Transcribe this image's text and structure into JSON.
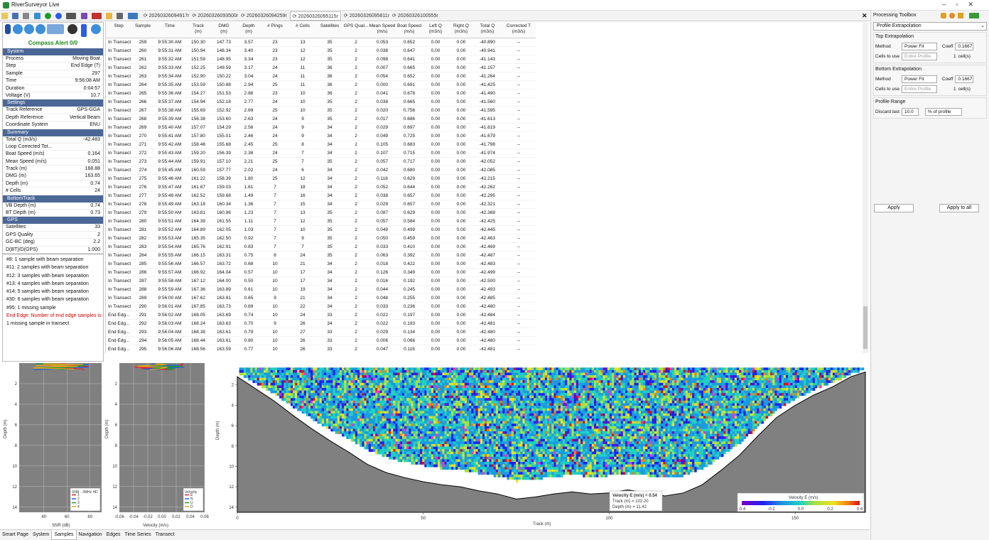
{
  "window": {
    "title": "RiverSurveyor Live",
    "controls": [
      "–",
      "▫",
      "✕"
    ]
  },
  "file_tabs": [
    "20260326094917r",
    "20260326093500r",
    "20260326094259r",
    "20260326095115r",
    "20260326095811r",
    "20260326100555r"
  ],
  "file_tab_selected": 3,
  "left": {
    "alert": "Compass Alert 0/0",
    "sections": [
      {
        "name": "System",
        "rows": [
          [
            "Process",
            "Moving Boat"
          ],
          [
            "Step",
            "End Edge (?)"
          ],
          [
            "Sample",
            "297"
          ],
          [
            "Time",
            "9:56:08 AM"
          ],
          [
            "Duration",
            "0:04:57"
          ],
          [
            "Voltage (V)",
            "10.7"
          ]
        ]
      },
      {
        "name": "Settings",
        "rows": [
          [
            "Track Reference",
            "GPS-GGA"
          ],
          [
            "Depth Reference",
            "Vertical Beam"
          ],
          [
            "Coordinate System",
            "ENU"
          ]
        ]
      },
      {
        "name": "Summary",
        "rows": [
          [
            "Total Q (m3/s)",
            "-42.483"
          ],
          [
            "Loop Corrected Tot...",
            ""
          ],
          [
            "Boat Speed (m/s)",
            "0.164"
          ],
          [
            "Mean Speed (m/s)",
            "0.051"
          ],
          [
            "Track (m)",
            "168.88"
          ],
          [
            "DMG (m)",
            "163.65"
          ],
          [
            "Depth (m)",
            "0.74"
          ],
          [
            "# Cells",
            "24"
          ]
        ]
      },
      {
        "name": "BottomTrack",
        "rows": [
          [
            "VB Depth (m)",
            "0.74"
          ],
          [
            "BT Depth (m)",
            "0.73"
          ]
        ]
      },
      {
        "name": "GPS",
        "rows": [
          [
            "Satellites",
            "33"
          ],
          [
            "GPS Quality",
            "2"
          ],
          [
            "GC-BC (deg)",
            "2.2"
          ],
          [
            "D(BT)/D(GPS)",
            "1.000"
          ]
        ]
      }
    ],
    "messages": [
      {
        "text": "#8: 1 sample with beam separation",
        "red": false
      },
      {
        "text": "#11: 2 samples with beam separation",
        "red": false
      },
      {
        "text": "#12: 3 samples with beam separation",
        "red": false
      },
      {
        "text": "#13: 4 samples with beam separation",
        "red": false
      },
      {
        "text": "#14: 5 samples with beam separation",
        "red": false
      },
      {
        "text": "#30: 6 samples with beam separation",
        "red": false
      },
      {
        "text": "#95: 1 missing sample",
        "red": false
      },
      {
        "text": "End Edge: Number of end edge samples is l",
        "red": true
      },
      {
        "text": "1 missing sample in transect",
        "red": false
      }
    ]
  },
  "table": {
    "headers": [
      "Step",
      "Sample",
      "Time",
      "Track\n(m)",
      "DMG\n(m)",
      "Depth\n(m)",
      "# Pings",
      "# Cells",
      "Satellites",
      "GPS Qual...",
      "Mean Speed\n(m/s)",
      "Boat Speed\n(m/s)",
      "Left Q\n(m3/s)",
      "Right Q\n(m3/s)",
      "Total Q\n(m3/s)",
      "Corrected T\n(m3/s)"
    ],
    "rows": [
      [
        "In Transect",
        "259",
        "9:55:30 AM",
        "150.30",
        "147.73",
        "3.57",
        "23",
        "13",
        "35",
        "2",
        "0.053",
        "0.652",
        "0.00",
        "0.00",
        "-40.890",
        "--"
      ],
      [
        "In Transect",
        "260",
        "9:55:31 AM",
        "150.94",
        "148.34",
        "3.40",
        "23",
        "12",
        "35",
        "2",
        "0.038",
        "0.647",
        "0.00",
        "0.00",
        "-40.941",
        "--"
      ],
      [
        "In Transect",
        "261",
        "9:55:32 AM",
        "151.59",
        "148.95",
        "3.34",
        "23",
        "12",
        "35",
        "2",
        "0.098",
        "0.641",
        "0.00",
        "0.00",
        "-41.143",
        "--"
      ],
      [
        "In Transect",
        "262",
        "9:55:33 AM",
        "152.25",
        "149.59",
        "3.17",
        "24",
        "11",
        "36",
        "2",
        "0.007",
        "0.665",
        "0.00",
        "0.00",
        "-41.157",
        "--"
      ],
      [
        "In Transect",
        "263",
        "9:55:34 AM",
        "152.90",
        "150.22",
        "3.04",
        "24",
        "11",
        "36",
        "2",
        "0.054",
        "0.652",
        "0.00",
        "0.00",
        "-41.264",
        "--"
      ],
      [
        "In Transect",
        "264",
        "9:55:35 AM",
        "153.59",
        "150.88",
        "2.94",
        "25",
        "11",
        "36",
        "2",
        "0.000",
        "0.691",
        "0.00",
        "0.00",
        "-41.425",
        "--"
      ],
      [
        "In Transect",
        "265",
        "9:55:36 AM",
        "154.27",
        "151.53",
        "2.88",
        "23",
        "10",
        "36",
        "2",
        "0.041",
        "0.678",
        "0.00",
        "0.00",
        "-41.490",
        "--"
      ],
      [
        "In Transect",
        "266",
        "9:55:37 AM",
        "154.94",
        "152.18",
        "2.77",
        "24",
        "10",
        "35",
        "2",
        "0.038",
        "0.665",
        "0.00",
        "0.00",
        "-41.560",
        "--"
      ],
      [
        "In Transect",
        "267",
        "9:55:38 AM",
        "155.69",
        "152.92",
        "2.69",
        "25",
        "10",
        "35",
        "2",
        "0.020",
        "0.756",
        "0.00",
        "0.00",
        "-41.595",
        "--"
      ],
      [
        "In Transect",
        "268",
        "9:55:39 AM",
        "156.38",
        "153.60",
        "2.63",
        "24",
        "9",
        "35",
        "2",
        "0.017",
        "0.686",
        "0.00",
        "0.00",
        "-41.613",
        "--"
      ],
      [
        "In Transect",
        "269",
        "9:55:40 AM",
        "157.07",
        "154.29",
        "2.56",
        "24",
        "9",
        "34",
        "2",
        "0.029",
        "0.697",
        "0.00",
        "0.00",
        "-41.619",
        "--"
      ],
      [
        "In Transect",
        "270",
        "9:55:41 AM",
        "157.80",
        "155.01",
        "2.46",
        "24",
        "9",
        "34",
        "2",
        "0.049",
        "0.725",
        "0.00",
        "0.00",
        "-41.679",
        "--"
      ],
      [
        "In Transect",
        "271",
        "9:55:42 AM",
        "158.48",
        "155.68",
        "2.45",
        "25",
        "8",
        "34",
        "2",
        "0.105",
        "0.683",
        "0.00",
        "0.00",
        "-41.798",
        "--"
      ],
      [
        "In Transect",
        "272",
        "9:55:43 AM",
        "159.20",
        "156.39",
        "2.38",
        "24",
        "7",
        "34",
        "2",
        "0.107",
        "0.715",
        "0.00",
        "0.00",
        "-41.974",
        "--"
      ],
      [
        "In Transect",
        "273",
        "9:55:44 AM",
        "159.91",
        "157.10",
        "2.21",
        "25",
        "7",
        "35",
        "2",
        "0.057",
        "0.717",
        "0.00",
        "0.00",
        "-42.052",
        "--"
      ],
      [
        "In Transect",
        "274",
        "9:55:45 AM",
        "160.59",
        "157.77",
        "2.02",
        "24",
        "6",
        "34",
        "2",
        "0.042",
        "0.680",
        "0.00",
        "0.00",
        "-42.085",
        "--"
      ],
      [
        "In Transect",
        "275",
        "9:55:46 AM",
        "161.22",
        "158.39",
        "1.80",
        "25",
        "12",
        "34",
        "2",
        "0.116",
        "0.629",
        "0.00",
        "0.00",
        "-42.215",
        "--"
      ],
      [
        "In Transect",
        "276",
        "9:55:47 AM",
        "161.87",
        "159.03",
        "1.61",
        "7",
        "18",
        "34",
        "2",
        "0.052",
        "0.644",
        "0.00",
        "0.00",
        "-42.262",
        "--"
      ],
      [
        "In Transect",
        "277",
        "9:55:48 AM",
        "162.52",
        "159.68",
        "1.49",
        "7",
        "16",
        "34",
        "2",
        "0.038",
        "0.657",
        "0.00",
        "0.00",
        "-42.295",
        "--"
      ],
      [
        "In Transect",
        "278",
        "9:55:49 AM",
        "163.18",
        "160.34",
        "1.36",
        "7",
        "15",
        "34",
        "2",
        "0.029",
        "0.657",
        "0.00",
        "0.00",
        "-42.321",
        "--"
      ],
      [
        "In Transect",
        "279",
        "9:55:50 AM",
        "163.81",
        "160.96",
        "1.23",
        "7",
        "13",
        "35",
        "2",
        "0.087",
        "0.629",
        "0.00",
        "0.00",
        "-42.388",
        "--"
      ],
      [
        "In Transect",
        "280",
        "9:55:51 AM",
        "164.39",
        "161.55",
        "1.11",
        "7",
        "12",
        "35",
        "2",
        "0.057",
        "0.584",
        "0.00",
        "0.00",
        "-42.425",
        "--"
      ],
      [
        "In Transect",
        "281",
        "9:55:52 AM",
        "164.89",
        "162.05",
        "1.03",
        "7",
        "10",
        "35",
        "2",
        "0.049",
        "0.499",
        "0.00",
        "0.00",
        "-42.445",
        "--"
      ],
      [
        "In Transect",
        "282",
        "9:55:53 AM",
        "165.35",
        "162.50",
        "0.92",
        "7",
        "9",
        "35",
        "2",
        "0.050",
        "0.459",
        "0.00",
        "0.00",
        "-42.463",
        "--"
      ],
      [
        "In Transect",
        "283",
        "9:55:54 AM",
        "165.76",
        "162.91",
        "0.83",
        "7",
        "7",
        "35",
        "2",
        "0.033",
        "0.410",
        "0.00",
        "0.00",
        "-42.469",
        "--"
      ],
      [
        "In Transect",
        "284",
        "9:55:55 AM",
        "166.15",
        "163.31",
        "0.75",
        "8",
        "24",
        "35",
        "2",
        "0.063",
        "0.392",
        "0.00",
        "0.00",
        "-42.487",
        "--"
      ],
      [
        "In Transect",
        "285",
        "9:55:56 AM",
        "166.57",
        "163.72",
        "0.68",
        "10",
        "21",
        "34",
        "2",
        "0.018",
        "0.422",
        "0.00",
        "0.00",
        "-42.483",
        "--"
      ],
      [
        "In Transect",
        "286",
        "9:55:57 AM",
        "166.92",
        "164.04",
        "0.57",
        "10",
        "17",
        "34",
        "2",
        "0.126",
        "0.349",
        "0.00",
        "0.00",
        "-42.499",
        "--"
      ],
      [
        "In Transect",
        "287",
        "9:55:58 AM",
        "167.12",
        "164.00",
        "0.50",
        "10",
        "17",
        "34",
        "2",
        "0.016",
        "0.192",
        "0.00",
        "0.00",
        "-42.500",
        "--"
      ],
      [
        "In Transect",
        "288",
        "9:55:59 AM",
        "167.36",
        "163.89",
        "0.61",
        "10",
        "19",
        "34",
        "2",
        "0.044",
        "0.245",
        "0.00",
        "0.00",
        "-42.493",
        "--"
      ],
      [
        "In Transect",
        "289",
        "9:56:00 AM",
        "167.62",
        "163.81",
        "0.65",
        "9",
        "21",
        "34",
        "2",
        "0.048",
        "0.255",
        "0.00",
        "0.00",
        "-42.485",
        "--"
      ],
      [
        "In Transect",
        "290",
        "9:56:01 AM",
        "167.85",
        "163.73",
        "0.69",
        "10",
        "22",
        "34",
        "2",
        "0.033",
        "0.236",
        "0.00",
        "0.00",
        "-42.480",
        "--"
      ],
      [
        "End Edg...",
        "291",
        "9:56:02 AM",
        "168.05",
        "163.69",
        "0.74",
        "10",
        "24",
        "33",
        "2",
        "0.022",
        "0.197",
        "0.00",
        "0.00",
        "-42.484",
        "--"
      ],
      [
        "End Edg...",
        "292",
        "9:56:03 AM",
        "168.24",
        "163.63",
        "0.70",
        "9",
        "26",
        "34",
        "2",
        "0.022",
        "0.193",
        "0.00",
        "0.00",
        "-42.481",
        "--"
      ],
      [
        "End Edg...",
        "293",
        "9:56:04 AM",
        "168.38",
        "163.61",
        "0.79",
        "10",
        "27",
        "33",
        "2",
        "0.029",
        "0.134",
        "0.00",
        "0.00",
        "-42.480",
        "--"
      ],
      [
        "End Edg...",
        "294",
        "9:56:05 AM",
        "168.44",
        "163.61",
        "0.80",
        "10",
        "26",
        "33",
        "2",
        "0.006",
        "0.066",
        "0.00",
        "0.00",
        "-42.480",
        "--"
      ],
      [
        "End Edg...",
        "295",
        "9:56:06 AM",
        "168.56",
        "163.59",
        "0.77",
        "10",
        "26",
        "33",
        "2",
        "0.047",
        "0.116",
        "0.00",
        "0.00",
        "-42.481",
        "--"
      ],
      [
        "End Edg...",
        "296",
        "9:56:07 AM",
        "168.71",
        "163.63",
        "0.75",
        "10",
        "25",
        "34",
        "2",
        "0.037",
        "0.154",
        "0.00",
        "0.00",
        "-42.482",
        "--"
      ],
      [
        "End Edg...",
        "297",
        "9:56:08 AM",
        "168.88",
        "163.65",
        "0.74",
        "10",
        "24",
        "33",
        "2",
        "0.051",
        "0.164",
        "0.00",
        "0.00",
        "-42.483",
        "--"
      ]
    ],
    "selected_row": 38
  },
  "toolbox": {
    "title": "Processing Toolbox",
    "mode": "Profile Extrapolation",
    "top": {
      "group": "Top Extrapolation",
      "method_label": "Method",
      "method": "Power Fit",
      "coeff_label": "Coeff",
      "coeff": "0.1667",
      "cells_label": "Cells to use",
      "cells_mode": "Entire Profile",
      "cells_n": "1",
      "cells_unit": "cell(s)"
    },
    "bottom": {
      "group": "Bottom Extrapolation",
      "method_label": "Method",
      "method": "Power Fit",
      "coeff_label": "Coeff",
      "coeff": "0.1667",
      "cells_label": "Cells to use",
      "cells_mode": "Entire Profile",
      "cells_n": "1",
      "cells_unit": "cell(s)"
    },
    "range": {
      "group": "Profile Range",
      "label": "Discard last",
      "value": "10.0",
      "unit": "% of profile"
    },
    "apply": "Apply",
    "apply_all": "Apply to all"
  },
  "bottom_tabs": [
    "Smart Page",
    "System",
    "Samples",
    "Navigation",
    "Edges",
    "Time Series",
    "Transect"
  ],
  "bottom_tab_selected": 2,
  "tooltip": {
    "title": "Velocity E (m/s) = 0.54",
    "track": "Track (m) = 102.20",
    "depth": "Depth (m) = 11.42"
  },
  "chart_data": [
    {
      "type": "line",
      "xlabel": "SNR (dB)",
      "ylabel": "Depth (m)",
      "xticks": [
        "40",
        "60",
        "80"
      ],
      "yticks": [
        "2",
        "4",
        "6",
        "8",
        "10",
        "12",
        "14"
      ],
      "legend_title": "SNR - 3MHz HD",
      "legend": [
        "1",
        "2",
        "3",
        "4"
      ],
      "legend_colors": [
        "#e0202a",
        "#2a5de0",
        "#1e9a2b",
        "#e8a81a"
      ]
    },
    {
      "type": "line",
      "xlabel": "Velocity (m/s)",
      "ylabel": "Depth (m)",
      "xticks": [
        "-0.06",
        "-0.04",
        "-0.02",
        "0.00",
        "0.02",
        "0.04",
        "0.06"
      ],
      "yticks": [
        "2",
        "4",
        "6",
        "8",
        "10",
        "12",
        "14"
      ],
      "legend_title": "Velocity",
      "legend": [
        "E",
        "N",
        "U",
        "D"
      ],
      "legend_colors": [
        "#e0202a",
        "#2a5de0",
        "#1e9a2b",
        "#e8a81a"
      ]
    },
    {
      "type": "heatmap",
      "xlabel": "Track (m)",
      "ylabel": "Depth (m)",
      "xticks": [
        "0",
        "50",
        "100",
        "150"
      ],
      "yticks": [
        "2",
        "4",
        "6",
        "8",
        "10",
        "12",
        "14"
      ],
      "xlim": [
        0,
        168.88
      ],
      "ylim": [
        0,
        14.5
      ],
      "colorbar_title": "Velocity E (m/s)",
      "colorbar_ticks": [
        "-0.4",
        "-0.2",
        "0.0",
        "0.2",
        "0.4"
      ],
      "clim": [
        -0.4,
        0.4
      ]
    }
  ]
}
